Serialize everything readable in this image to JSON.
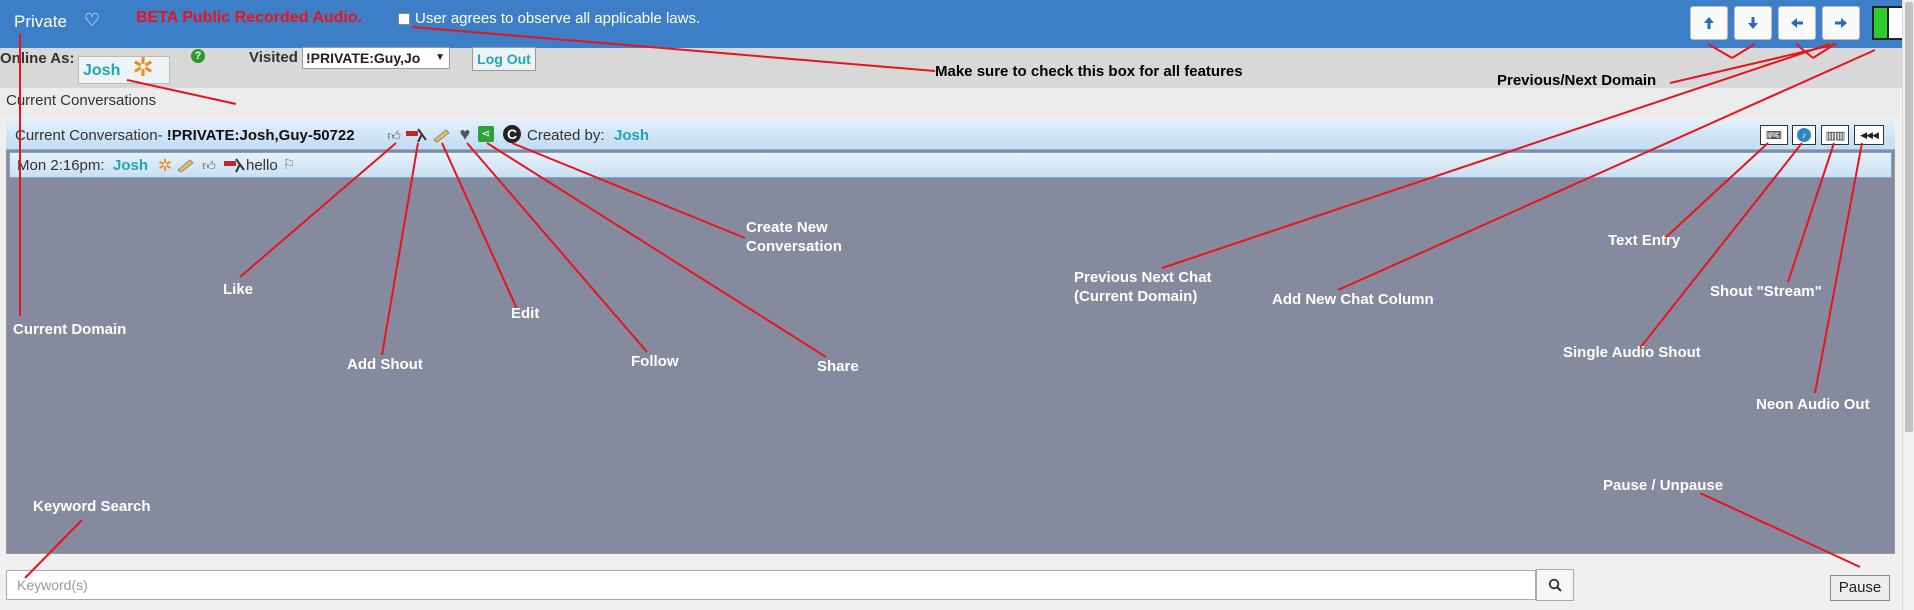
{
  "topbar": {
    "domain": "Private",
    "beta_notice": "BETA Public Recorded Audio.",
    "agree_label": "User agrees to observe all applicable laws.",
    "agree_checked": false,
    "nav_buttons": [
      {
        "name": "arrow-up-icon",
        "glyph": "🡅"
      },
      {
        "name": "arrow-down-icon",
        "glyph": "🡇"
      },
      {
        "name": "arrow-left-icon",
        "glyph": "🡄"
      },
      {
        "name": "arrow-right-icon",
        "glyph": "🡆"
      }
    ]
  },
  "session": {
    "online_label": "Online As:",
    "user": "Josh",
    "visited_label": "Visited",
    "visited_value": "!PRIVATE:Guy,Jo",
    "logout": "Log Out"
  },
  "conversations_header": "Current Conversations",
  "conversation": {
    "prefix": "Current Conversation-",
    "name": "!PRIVATE:Josh,Guy-50722",
    "created_by_label": "Created by:",
    "created_by": "Josh",
    "tools": [
      "keyboard-icon",
      "microphone-icon",
      "stream-icon",
      "audio-out-icon"
    ]
  },
  "message": {
    "time": "Mon 2:16pm:",
    "user": "Josh",
    "text": "hello"
  },
  "search": {
    "placeholder": "Keyword(s)",
    "value": ""
  },
  "pause_label": "Pause",
  "annotations": {
    "check_box_note": "Make sure to check this box for all features",
    "prev_next_domain": "Previous/Next Domain",
    "current_domain": "Current Domain",
    "like": "Like",
    "add_shout": "Add Shout",
    "edit": "Edit",
    "follow": "Follow",
    "share": "Share",
    "create_new_conversation_1": "Create New",
    "create_new_conversation_2": "Conversation",
    "prev_next_chat_1": "Previous Next Chat",
    "prev_next_chat_2": "(Current Domain)",
    "add_new_chat_column": "Add New Chat Column",
    "text_entry": "Text Entry",
    "shout_stream": "Shout \"Stream\"",
    "single_audio_shout": "Single Audio Shout",
    "neon_audio_out": "Neon Audio Out",
    "pause_unpause": "Pause / Unpause",
    "keyword_search": "Keyword Search"
  },
  "colors": {
    "topbar": "#3d7fc6",
    "panel": "#858a9e",
    "annotation_line": "#e8141c",
    "user_name": "#1fa7b8"
  }
}
